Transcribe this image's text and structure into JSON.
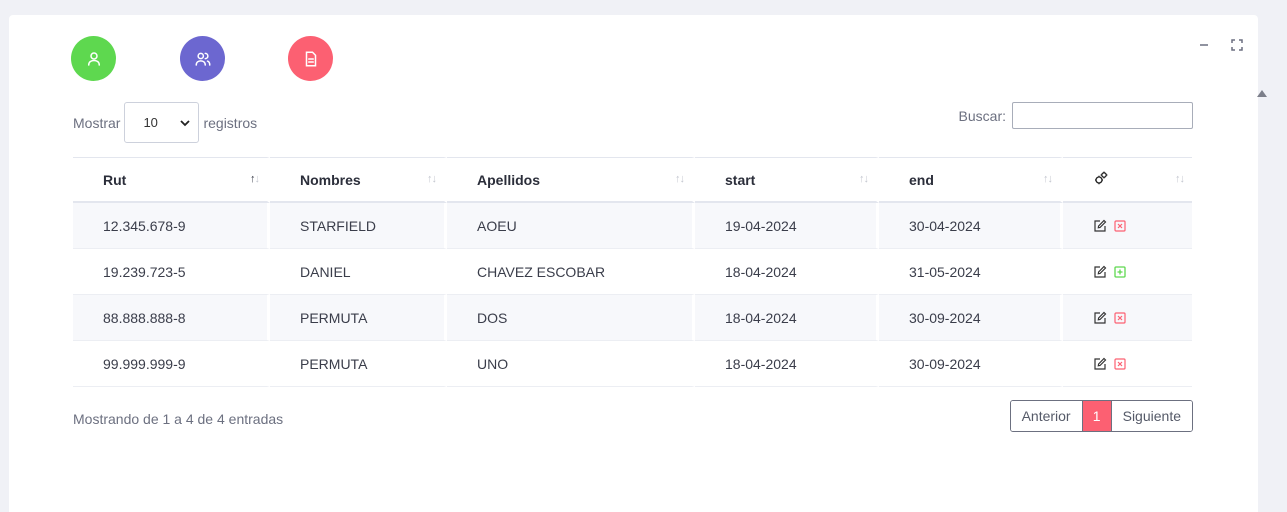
{
  "top_buttons": [
    {
      "icon": "user-icon",
      "color": "#5ed84f"
    },
    {
      "icon": "users-icon",
      "color": "#6c67d0"
    },
    {
      "icon": "document-icon",
      "color": "#fc6072"
    }
  ],
  "length": {
    "label_before": "Mostrar",
    "selected": "10",
    "label_after": "registros"
  },
  "search": {
    "label": "Buscar:",
    "placeholder": "",
    "value": ""
  },
  "table": {
    "columns": [
      "Rut",
      "Nombres",
      "Apellidos",
      "start",
      "end"
    ],
    "action_column_icon": "gears-icon",
    "sorted_column": "Rut",
    "rows": [
      {
        "rut": "12.345.678-9",
        "nombres": "STARFIELD",
        "apellidos": "AOEU",
        "start": "19-04-2024",
        "end": "30-04-2024",
        "status_icon": "remove-icon"
      },
      {
        "rut": "19.239.723-5",
        "nombres": "DANIEL",
        "apellidos": "CHAVEZ ESCOBAR",
        "start": "18-04-2024",
        "end": "31-05-2024",
        "status_icon": "add-icon"
      },
      {
        "rut": "88.888.888-8",
        "nombres": "PERMUTA",
        "apellidos": "DOS",
        "start": "18-04-2024",
        "end": "30-09-2024",
        "status_icon": "remove-icon"
      },
      {
        "rut": "99.999.999-9",
        "nombres": "PERMUTA",
        "apellidos": "UNO",
        "start": "18-04-2024",
        "end": "30-09-2024",
        "status_icon": "remove-icon"
      }
    ]
  },
  "info": "Mostrando de 1 a 4 de 4 entradas",
  "pagination": {
    "prev": "Anterior",
    "current": "1",
    "next": "Siguiente"
  },
  "colors": {
    "accent": "#fc6072",
    "add": "#5ed84f",
    "remove": "#fc6072"
  }
}
